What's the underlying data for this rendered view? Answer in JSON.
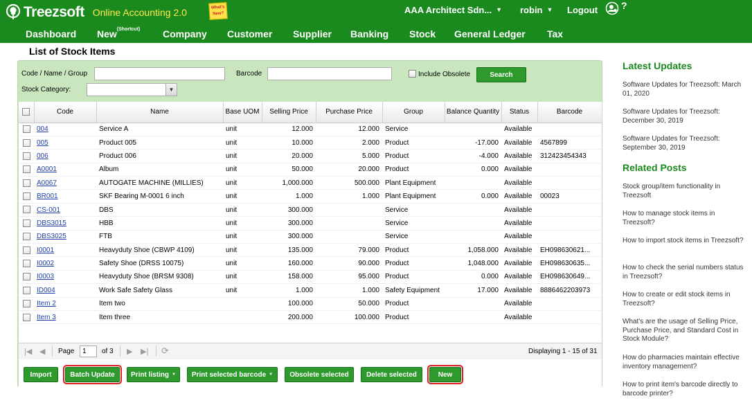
{
  "app": {
    "brand": "Treezsoft",
    "tagline": "Online Accounting 2.0",
    "note": "What's New?",
    "company": "AAA Architect Sdn...",
    "user": "robin",
    "logout": "Logout",
    "help": "?"
  },
  "nav": {
    "dashboard": "Dashboard",
    "new": "New",
    "new_sup": "(Shortcut)",
    "company": "Company",
    "customer": "Customer",
    "supplier": "Supplier",
    "banking": "Banking",
    "stock": "Stock",
    "ledger": "General Ledger",
    "tax": "Tax"
  },
  "page": {
    "title": "List of Stock Items"
  },
  "filters": {
    "code_label": "Code / Name / Group",
    "barcode_label": "Barcode",
    "obsolete_label": "Include Obsolete",
    "search": "Search",
    "category_label": "Stock Category:"
  },
  "columns": [
    "Code",
    "Name",
    "Base UOM",
    "Selling Price",
    "Purchase Price",
    "Group",
    "Balance Quantity",
    "Status",
    "Barcode"
  ],
  "rows": [
    [
      "004",
      "Service A",
      "unit",
      "12.000",
      "12.000",
      "Service",
      "",
      "Available",
      ""
    ],
    [
      "005",
      "Product 005",
      "unit",
      "10.000",
      "2.000",
      "Product",
      "-17.000",
      "Available",
      "4567899"
    ],
    [
      "006",
      "Product 006",
      "unit",
      "20.000",
      "5.000",
      "Product",
      "-4.000",
      "Available",
      "312423454343"
    ],
    [
      "A0001",
      "Album",
      "unit",
      "50.000",
      "20.000",
      "Product",
      "0.000",
      "Available",
      ""
    ],
    [
      "A0067",
      "AUTOGATE MACHINE (MILLIES)",
      "unit",
      "1,000.000",
      "500.000",
      "Plant Equipment",
      "",
      "Available",
      ""
    ],
    [
      "BR001",
      "SKF Bearing M-0001 6 inch",
      "unit",
      "1.000",
      "1.000",
      "Plant Equipment",
      "0.000",
      "Available",
      "00023"
    ],
    [
      "CS-001",
      "DBS",
      "unit",
      "300.000",
      "",
      "Service",
      "",
      "Available",
      ""
    ],
    [
      "DBS3015",
      "HBB",
      "unit",
      "300.000",
      "",
      "Service",
      "",
      "Available",
      ""
    ],
    [
      "DBS3025",
      "FTB",
      "unit",
      "300.000",
      "",
      "Service",
      "",
      "Available",
      ""
    ],
    [
      "I0001",
      "Heavyduty Shoe (CBWP 4109)",
      "unit",
      "135.000",
      "79.000",
      "Product",
      "1,058.000",
      "Available",
      "EH098630621..."
    ],
    [
      "I0002",
      "Safety Shoe (DRSS 10075)",
      "unit",
      "160.000",
      "90.000",
      "Product",
      "1,048.000",
      "Available",
      "EH098630635..."
    ],
    [
      "I0003",
      "Heavyduty Shoe (BRSM 9308)",
      "unit",
      "158.000",
      "95.000",
      "Product",
      "0.000",
      "Available",
      "EH098630649..."
    ],
    [
      "ID004",
      "Work Safe Safety Glass",
      "unit",
      "1.000",
      "1.000",
      "Safety Equipment",
      "17.000",
      "Available",
      "8886462203973"
    ],
    [
      "Item 2",
      "Item two",
      "",
      "100.000",
      "50.000",
      "Product",
      "",
      "Available",
      ""
    ],
    [
      "Item 3",
      "Item three",
      "",
      "200.000",
      "100.000",
      "Product",
      "",
      "Available",
      ""
    ]
  ],
  "pager": {
    "page_label": "Page",
    "page": "1",
    "of": "of 3",
    "display": "Displaying 1 - 15 of 31"
  },
  "actions": {
    "import": "Import",
    "batch": "Batch Update",
    "print_listing": "Print listing",
    "print_barcode": "Print selected barcode",
    "obsolete": "Obsolete selected",
    "delete": "Delete selected",
    "new": "New"
  },
  "sidebar": {
    "updates_title": "Latest Updates",
    "updates": [
      "Software Updates for Treezsoft: March 01, 2020",
      "Software Updates for Treezsoft: December 30, 2019",
      "Software Updates for Treezsoft: September 30, 2019"
    ],
    "related_title": "Related Posts",
    "related": [
      "Stock group/item functionality in Treezsoft",
      "How to manage stock items in Treezsoft?",
      "How to import stock items in Treezsoft?",
      "How to check the serial numbers status in Treezsoft?",
      "How to create or edit stock items in Treezsoft?",
      "What's are the usage of Selling Price, Purchase Price, and Standard Cost in Stock Module?",
      "How do pharmacies maintain effective inventory management?",
      "How to print item's barcode directly to barcode printer?"
    ]
  },
  "colors": {
    "brand_green": "#1a8a1e",
    "tagline_yellow": "#ffe94d",
    "panel_green": "#c9e6bf",
    "highlight_red": "#e02020"
  }
}
